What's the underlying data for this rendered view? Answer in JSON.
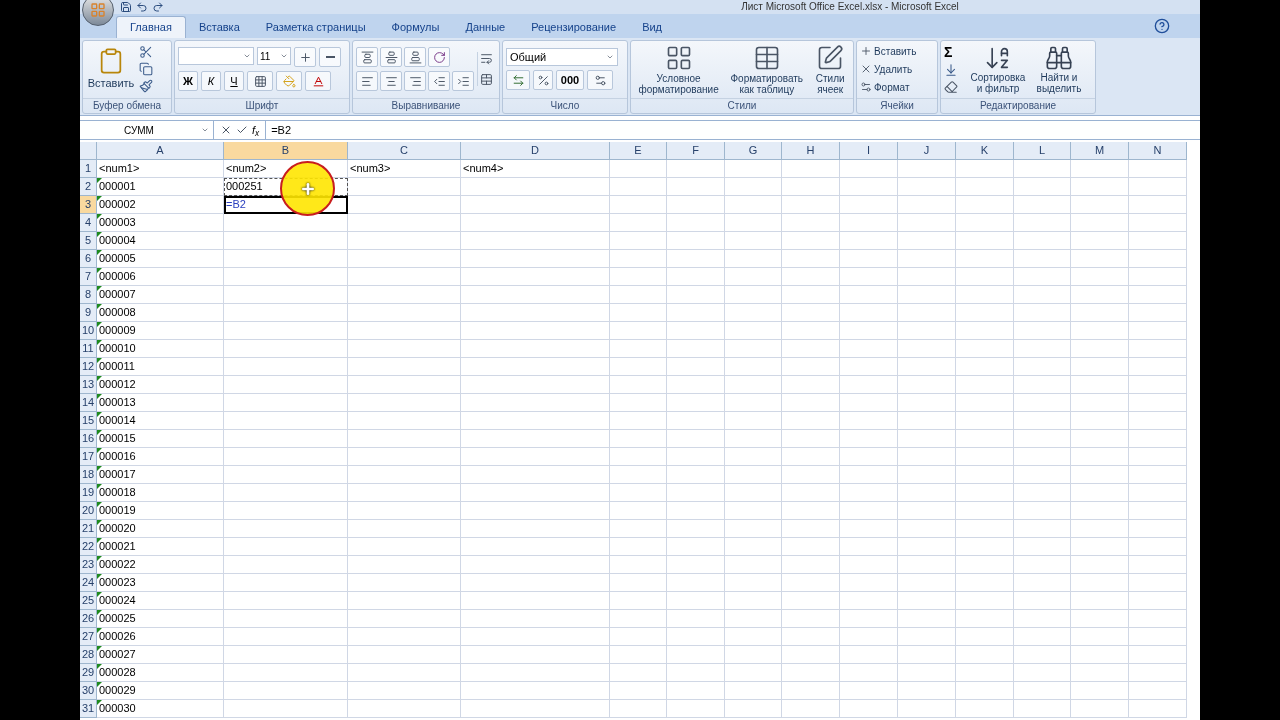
{
  "window": {
    "title": "Лист Microsoft Office Excel.xlsx - Microsoft Excel"
  },
  "tabs": [
    {
      "label": "Главная",
      "selected": true
    },
    {
      "label": "Вставка",
      "selected": false
    },
    {
      "label": "Разметка страницы",
      "selected": false
    },
    {
      "label": "Формулы",
      "selected": false
    },
    {
      "label": "Данные",
      "selected": false
    },
    {
      "label": "Рецензирование",
      "selected": false
    },
    {
      "label": "Вид",
      "selected": false
    }
  ],
  "ribbon": [
    {
      "kind": "clipboard",
      "label": "Буфер обмена",
      "paste": "Вставить"
    },
    {
      "kind": "font",
      "label": "Шрифт",
      "size": "11",
      "bold": "Ж",
      "italic": "К",
      "underline": "Ч"
    },
    {
      "kind": "alignment",
      "label": "Выравнивание"
    },
    {
      "kind": "number",
      "label": "Число",
      "format": "Общий",
      "thousands": "000"
    },
    {
      "kind": "styles",
      "label": "Стили",
      "buttons": [
        "Условное форматирование",
        "Форматировать как таблицу",
        "Стили ячеек"
      ]
    },
    {
      "kind": "cells",
      "label": "Ячейки",
      "buttons": [
        "Вставить",
        "Удалить",
        "Формат"
      ]
    },
    {
      "kind": "editing",
      "label": "Редактирование",
      "sum": "Σ",
      "buttons": [
        "Сортировка и фильтр",
        "Найти и выделить"
      ]
    }
  ],
  "formula_bar": {
    "name_box": "СУММ",
    "function_button": "f$_{x}$",
    "formula": "=B2"
  },
  "columns": [
    {
      "label": "A",
      "selected": false
    },
    {
      "label": "B",
      "selected": true
    },
    {
      "label": "C",
      "selected": false
    },
    {
      "label": "D",
      "selected": false
    },
    {
      "label": "E",
      "selected": false
    },
    {
      "label": "F",
      "selected": false
    },
    {
      "label": "G",
      "selected": false
    },
    {
      "label": "H",
      "selected": false
    },
    {
      "label": "I",
      "selected": false
    },
    {
      "label": "J",
      "selected": false
    },
    {
      "label": "K",
      "selected": false
    },
    {
      "label": "L",
      "selected": false
    },
    {
      "label": "M",
      "selected": false
    },
    {
      "label": "N",
      "selected": false
    }
  ],
  "rows": [
    {
      "label": "1",
      "selected": false,
      "cells": [
        {
          "kind": "value",
          "text": "<num1>",
          "error_mark": false
        },
        {
          "kind": "value",
          "text": "<num2>",
          "error_mark": false
        },
        {
          "kind": "value",
          "text": "<num3>",
          "error_mark": false
        },
        {
          "kind": "value",
          "text": "<num4>",
          "error_mark": false
        }
      ]
    },
    {
      "label": "2",
      "selected": false,
      "cells": [
        {
          "kind": "value",
          "text": "000001",
          "error_mark": true
        },
        {
          "kind": "reference",
          "text": "000251",
          "error_mark": false
        }
      ]
    },
    {
      "label": "3",
      "selected": true,
      "cells": [
        {
          "kind": "value",
          "text": "000002",
          "error_mark": true
        },
        {
          "kind": "editing",
          "text": "=B2",
          "error_mark": false
        }
      ]
    },
    {
      "label": "4",
      "selected": false,
      "cells": [
        {
          "kind": "value",
          "text": "000003",
          "error_mark": true
        }
      ]
    },
    {
      "label": "5",
      "selected": false,
      "cells": [
        {
          "kind": "value",
          "text": "000004",
          "error_mark": true
        }
      ]
    },
    {
      "label": "6",
      "selected": false,
      "cells": [
        {
          "kind": "value",
          "text": "000005",
          "error_mark": true
        }
      ]
    },
    {
      "label": "7",
      "selected": false,
      "cells": [
        {
          "kind": "value",
          "text": "000006",
          "error_mark": true
        }
      ]
    },
    {
      "label": "8",
      "selected": false,
      "cells": [
        {
          "kind": "value",
          "text": "000007",
          "error_mark": true
        }
      ]
    },
    {
      "label": "9",
      "selected": false,
      "cells": [
        {
          "kind": "value",
          "text": "000008",
          "error_mark": true
        }
      ]
    },
    {
      "label": "10",
      "selected": false,
      "cells": [
        {
          "kind": "value",
          "text": "000009",
          "error_mark": true
        }
      ]
    },
    {
      "label": "11",
      "selected": false,
      "cells": [
        {
          "kind": "value",
          "text": "000010",
          "error_mark": true
        }
      ]
    },
    {
      "label": "12",
      "selected": false,
      "cells": [
        {
          "kind": "value",
          "text": "000011",
          "error_mark": true
        }
      ]
    },
    {
      "label": "13",
      "selected": false,
      "cells": [
        {
          "kind": "value",
          "text": "000012",
          "error_mark": true
        }
      ]
    },
    {
      "label": "14",
      "selected": false,
      "cells": [
        {
          "kind": "value",
          "text": "000013",
          "error_mark": true
        }
      ]
    },
    {
      "label": "15",
      "selected": false,
      "cells": [
        {
          "kind": "value",
          "text": "000014",
          "error_mark": true
        }
      ]
    },
    {
      "label": "16",
      "selected": false,
      "cells": [
        {
          "kind": "value",
          "text": "000015",
          "error_mark": true
        }
      ]
    },
    {
      "label": "17",
      "selected": false,
      "cells": [
        {
          "kind": "value",
          "text": "000016",
          "error_mark": true
        }
      ]
    },
    {
      "label": "18",
      "selected": false,
      "cells": [
        {
          "kind": "value",
          "text": "000017",
          "error_mark": true
        }
      ]
    },
    {
      "label": "19",
      "selected": false,
      "cells": [
        {
          "kind": "value",
          "text": "000018",
          "error_mark": true
        }
      ]
    },
    {
      "label": "20",
      "selected": false,
      "cells": [
        {
          "kind": "value",
          "text": "000019",
          "error_mark": true
        }
      ]
    },
    {
      "label": "21",
      "selected": false,
      "cells": [
        {
          "kind": "value",
          "text": "000020",
          "error_mark": true
        }
      ]
    },
    {
      "label": "22",
      "selected": false,
      "cells": [
        {
          "kind": "value",
          "text": "000021",
          "error_mark": true
        }
      ]
    },
    {
      "label": "23",
      "selected": false,
      "cells": [
        {
          "kind": "value",
          "text": "000022",
          "error_mark": true
        }
      ]
    },
    {
      "label": "24",
      "selected": false,
      "cells": [
        {
          "kind": "value",
          "text": "000023",
          "error_mark": true
        }
      ]
    },
    {
      "label": "25",
      "selected": false,
      "cells": [
        {
          "kind": "value",
          "text": "000024",
          "error_mark": true
        }
      ]
    },
    {
      "label": "26",
      "selected": false,
      "cells": [
        {
          "kind": "value",
          "text": "000025",
          "error_mark": true
        }
      ]
    },
    {
      "label": "27",
      "selected": false,
      "cells": [
        {
          "kind": "value",
          "text": "000026",
          "error_mark": true
        }
      ]
    },
    {
      "label": "28",
      "selected": false,
      "cells": [
        {
          "kind": "value",
          "text": "000027",
          "error_mark": true
        }
      ]
    },
    {
      "label": "29",
      "selected": false,
      "cells": [
        {
          "kind": "value",
          "text": "000028",
          "error_mark": true
        }
      ]
    },
    {
      "label": "30",
      "selected": false,
      "cells": [
        {
          "kind": "value",
          "text": "000029",
          "error_mark": true
        }
      ]
    },
    {
      "label": "31",
      "selected": false,
      "cells": [
        {
          "kind": "value",
          "text": "000030",
          "error_mark": true
        }
      ]
    }
  ]
}
